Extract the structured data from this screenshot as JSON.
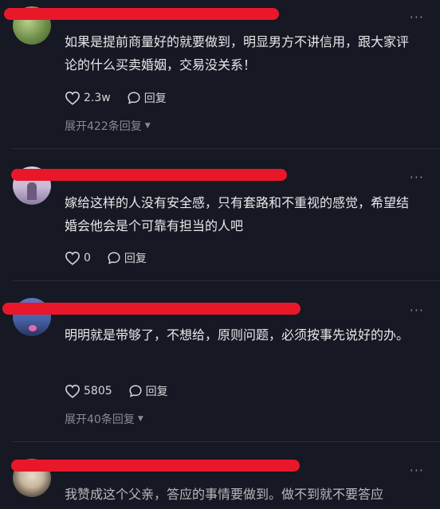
{
  "comments": [
    {
      "text": "如果是提前商量好的就要做到，明显男方不讲信用，跟大家评论的什么买卖婚姻，交易没关系！",
      "likes": "2.3w",
      "reply_label": "回复",
      "expand": "展开422条回复"
    },
    {
      "text": "嫁给这样的人没有安全感，只有套路和不重视的感觉，希望结婚会他会是个可靠有担当的人吧",
      "likes": "0",
      "reply_label": "回复"
    },
    {
      "text": "明明就是带够了，不想给，原则问题，必须按事先说好的办。",
      "likes": "5805",
      "reply_label": "回复",
      "expand": "展开40条回复"
    },
    {
      "text": "我赞成这个父亲，答应的事情要做到。做不到就不要答应"
    }
  ],
  "more_glyph": "···",
  "colors": {
    "redaction": "#e8182a",
    "background": "#161823"
  }
}
